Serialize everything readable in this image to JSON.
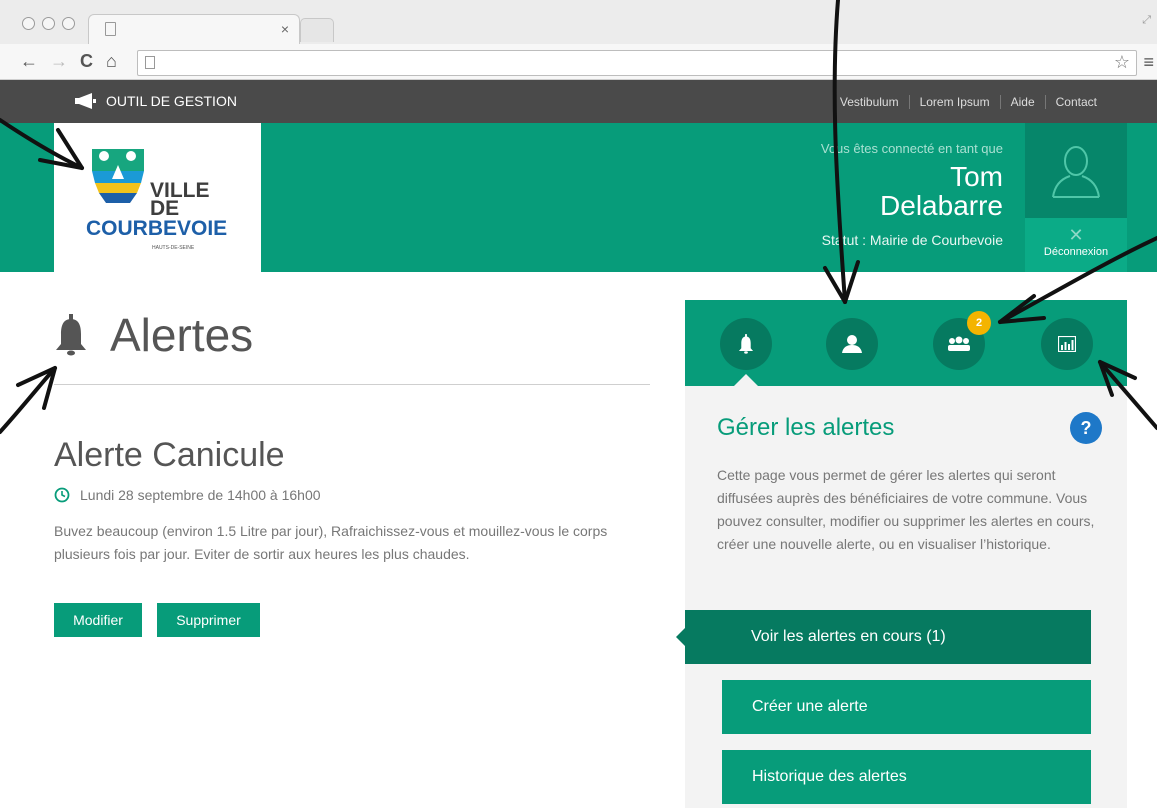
{
  "browser": {
    "tab_close": "×",
    "nav": {
      "back": "←",
      "forward": "→",
      "reload": "C",
      "home": "⌂"
    },
    "bookmark_star": "☆",
    "menu": "≡"
  },
  "topbar": {
    "brand": "OUTIL DE GESTION",
    "brand_icon": "megaphone-icon",
    "links": [
      "Vestibulum",
      "Lorem Ipsum",
      "Aide",
      "Contact"
    ]
  },
  "header": {
    "logo": {
      "line1": "VILLE",
      "line2": "DE",
      "line3": "COURBEVOIE",
      "sub": "HAUTS-DE-SEINE"
    },
    "connected_as": "Vous êtes connecté en tant que",
    "user_first": "Tom",
    "user_last": "Delabarre",
    "status": "Statut : Mairie de Courbevoie",
    "logout_icon": "✕",
    "logout": "Déconnexion"
  },
  "main": {
    "title": "Alertes",
    "title_icon": "bell-icon",
    "alert": {
      "title": "Alerte Canicule",
      "date": "Lundi 28 septembre de 14h00 à 16h00",
      "text": "Buvez beaucoup (environ 1.5 Litre par jour), Rafraichissez-vous et mouillez-vous le corps plusieurs fois par jour. Eviter de sortir aux heures les plus chaudes."
    },
    "buttons": {
      "edit": "Modifier",
      "delete": "Supprimer"
    }
  },
  "sidebar": {
    "icons": [
      "bell-icon",
      "user-icon",
      "group-icon",
      "chart-icon"
    ],
    "badge": "2",
    "title": "Gérer les alertes",
    "help": "?",
    "description": "Cette page vous permet de gérer les alertes qui seront diffusées auprès des bénéficiaires de votre commune. Vous pouvez consulter, modifier ou supprimer les alertes en cours, créer une nouvelle alerte, ou en visualiser l’historique.",
    "menu": [
      "Voir les alertes en cours (1)",
      "Créer une alerte",
      "Historique des alertes"
    ]
  },
  "colors": {
    "brand_green": "#079c7a",
    "dark_green": "#067a60",
    "topbar": "#4a4a4a",
    "badge": "#f4b400",
    "help": "#1e78c8"
  }
}
